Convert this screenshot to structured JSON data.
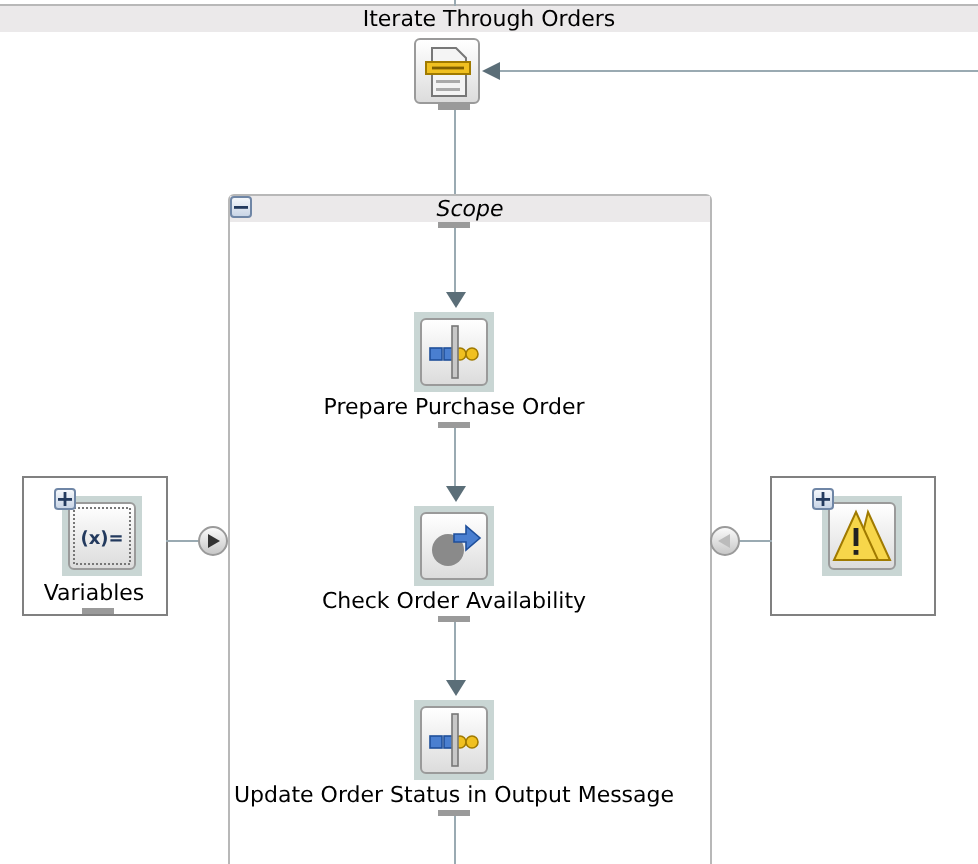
{
  "loop": {
    "title": "Iterate Through Orders",
    "start": {
      "kind": "document"
    }
  },
  "scope": {
    "title": "Scope",
    "expanded": true,
    "activities": [
      {
        "label": "Prepare Purchase Order",
        "kind": "assign"
      },
      {
        "label": "Check Order Availability",
        "kind": "invoke"
      },
      {
        "label": "Update Order Status in Output Message",
        "kind": "assign"
      }
    ],
    "variables": {
      "label": "Variables",
      "icon_text": "(x)=",
      "expanded": false
    },
    "fault_handlers": {
      "expanded": false
    }
  }
}
